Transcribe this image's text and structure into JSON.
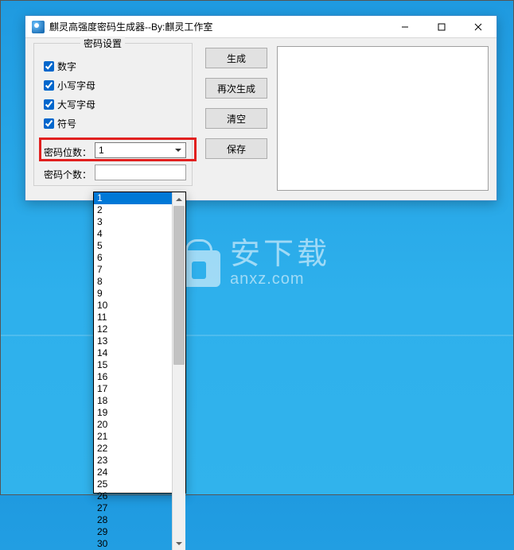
{
  "window": {
    "title": "麒灵高强度密码生成器--By:麒灵工作室"
  },
  "groupbox": {
    "legend": "密码设置",
    "opt_digits": "数字",
    "opt_lower": "小写字母",
    "opt_upper": "大写字母",
    "opt_symbols": "符号",
    "length_label": "密码位数：",
    "length_value": "1",
    "length_selected_index": 0,
    "length_options": [
      "1",
      "2",
      "3",
      "4",
      "5",
      "6",
      "7",
      "8",
      "9",
      "10",
      "11",
      "12",
      "13",
      "14",
      "15",
      "16",
      "17",
      "18",
      "19",
      "20",
      "21",
      "22",
      "23",
      "24",
      "25",
      "26",
      "27",
      "28",
      "29",
      "30"
    ],
    "length_has_more": true,
    "count_label": "密码个数：",
    "count_value": ""
  },
  "buttons": {
    "generate": "生成",
    "regenerate": "再次生成",
    "clear": "清空",
    "save": "保存"
  },
  "titlebar_controls": {
    "minimize": "minimize",
    "maximize": "maximize",
    "close": "close"
  },
  "watermark": {
    "line1": "安下载",
    "line2": "anxz.com"
  }
}
